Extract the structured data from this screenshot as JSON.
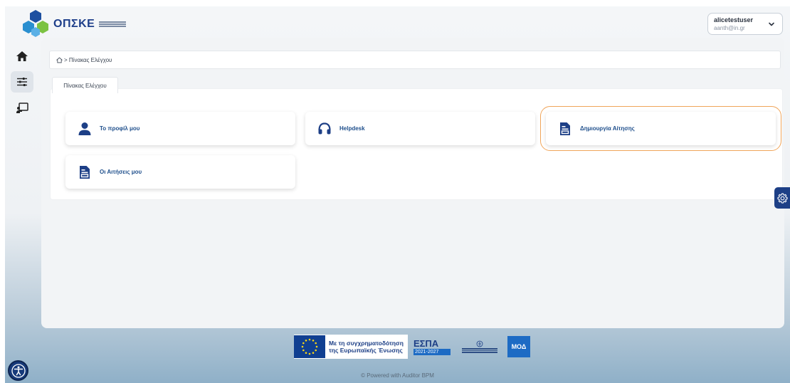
{
  "header": {
    "logo_text": "ΟΠΣΚΕ",
    "user": {
      "name": "alicetestuser",
      "email": "aanth@in.gr"
    }
  },
  "breadcrumb": {
    "current": "> Πίνακας Ελέγχου"
  },
  "tab": {
    "label": "Πίνακας Ελέγχου"
  },
  "tiles": [
    {
      "label": "Το προφίλ μου",
      "icon": "user-icon"
    },
    {
      "label": "Helpdesk",
      "icon": "headset-icon"
    },
    {
      "label": "Δημιουργία Αίτησης",
      "icon": "document-icon"
    },
    {
      "label": "Οι Αιτήσεις μου",
      "icon": "document-icon"
    }
  ],
  "footer": {
    "eu_text_line1": "Με τη συγχρηματοδότηση",
    "eu_text_line2": "της Ευρωπαϊκής Ένωσης",
    "espa_title": "ΕΣΠΑ",
    "espa_years": "2021-2027",
    "moa_label": "ΜΟΔ",
    "powered_by": "© Powered with Auditor BPM"
  },
  "colors": {
    "brand_blue": "#1d3f86",
    "tile_text": "#1f4f8c",
    "highlight_outline": "#f0a55a"
  }
}
